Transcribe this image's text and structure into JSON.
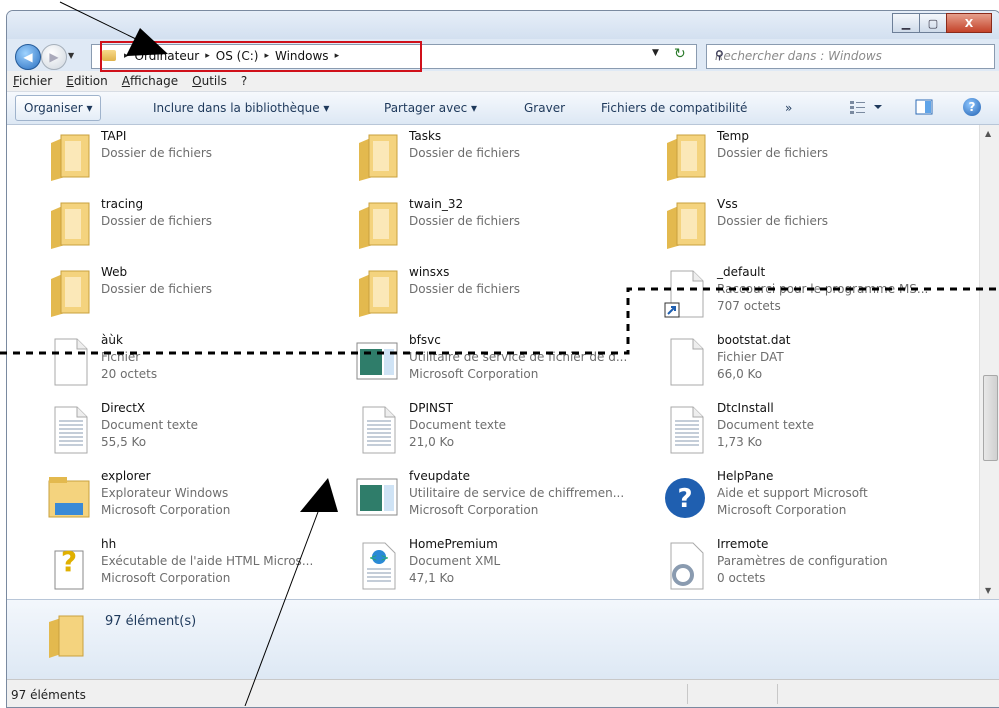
{
  "window": {
    "min_label": "▁",
    "max_label": "▢",
    "close_label": "X"
  },
  "nav": {
    "back_label": "◀",
    "forward_label": "▶",
    "history_dropdown": "▼"
  },
  "address": {
    "crumbs": [
      "Ordinateur",
      "OS (C:)",
      "Windows"
    ],
    "separator": "▸",
    "dropdown": "▼",
    "refresh": "↻"
  },
  "search": {
    "placeholder": "Rechercher dans : Windows",
    "icon": "search-icon",
    "glyph": "⚲"
  },
  "menubar": {
    "items": [
      "Fichier",
      "Edition",
      "Affichage",
      "Outils",
      "?"
    ]
  },
  "toolbar": {
    "organize": "Organiser ▾",
    "include": "Inclure dans la bibliothèque ▾",
    "share": "Partager avec ▾",
    "burn": "Graver",
    "compat": "Fichiers de compatibilité",
    "more": "»",
    "help": "?"
  },
  "files": [
    {
      "name": "TAPI",
      "type": "Dossier de fichiers",
      "info": "",
      "icon": "folder"
    },
    {
      "name": "Tasks",
      "type": "Dossier de fichiers",
      "info": "",
      "icon": "folder"
    },
    {
      "name": "Temp",
      "type": "Dossier de fichiers",
      "info": "",
      "icon": "folder"
    },
    {
      "name": "tracing",
      "type": "Dossier de fichiers",
      "info": "",
      "icon": "folder"
    },
    {
      "name": "twain_32",
      "type": "Dossier de fichiers",
      "info": "",
      "icon": "folder"
    },
    {
      "name": "Vss",
      "type": "Dossier de fichiers",
      "info": "",
      "icon": "folder"
    },
    {
      "name": "Web",
      "type": "Dossier de fichiers",
      "info": "",
      "icon": "folder"
    },
    {
      "name": "winsxs",
      "type": "Dossier de fichiers",
      "info": "",
      "icon": "folder"
    },
    {
      "name": "_default",
      "type": "Raccourci pour le programme MS...",
      "info": "707 octets",
      "icon": "shortcut"
    },
    {
      "name": "àùk",
      "type": "Fichier",
      "info": "20 octets",
      "icon": "blank"
    },
    {
      "name": "bfsvc",
      "type": "Utilitaire de service de fichier de d...",
      "info": "Microsoft Corporation",
      "icon": "app"
    },
    {
      "name": "bootstat.dat",
      "type": "Fichier DAT",
      "info": "66,0 Ko",
      "icon": "blank"
    },
    {
      "name": "DirectX",
      "type": "Document texte",
      "info": "55,5 Ko",
      "icon": "text"
    },
    {
      "name": "DPINST",
      "type": "Document texte",
      "info": "21,0 Ko",
      "icon": "text"
    },
    {
      "name": "DtcInstall",
      "type": "Document texte",
      "info": "1,73 Ko",
      "icon": "text"
    },
    {
      "name": "explorer",
      "type": "Explorateur Windows",
      "info": "Microsoft Corporation",
      "icon": "explorer"
    },
    {
      "name": "fveupdate",
      "type": "Utilitaire de service de chiffremen...",
      "info": "Microsoft Corporation",
      "icon": "app"
    },
    {
      "name": "HelpPane",
      "type": "Aide et support Microsoft",
      "info": "Microsoft Corporation",
      "icon": "help"
    },
    {
      "name": "hh",
      "type": "Exécutable de l'aide HTML Micros...",
      "info": "Microsoft Corporation",
      "icon": "hh"
    },
    {
      "name": "HomePremium",
      "type": "Document XML",
      "info": "47,1 Ko",
      "icon": "xml"
    },
    {
      "name": "Irremote",
      "type": "Paramètres de configuration",
      "info": "0 octets",
      "icon": "config"
    }
  ],
  "details": {
    "count": "97 élément(s)"
  },
  "status": {
    "text": "97 éléments"
  },
  "colors": {
    "accent": "#1e395b",
    "highlight_box": "#d0101a",
    "annotation": "#000000"
  }
}
